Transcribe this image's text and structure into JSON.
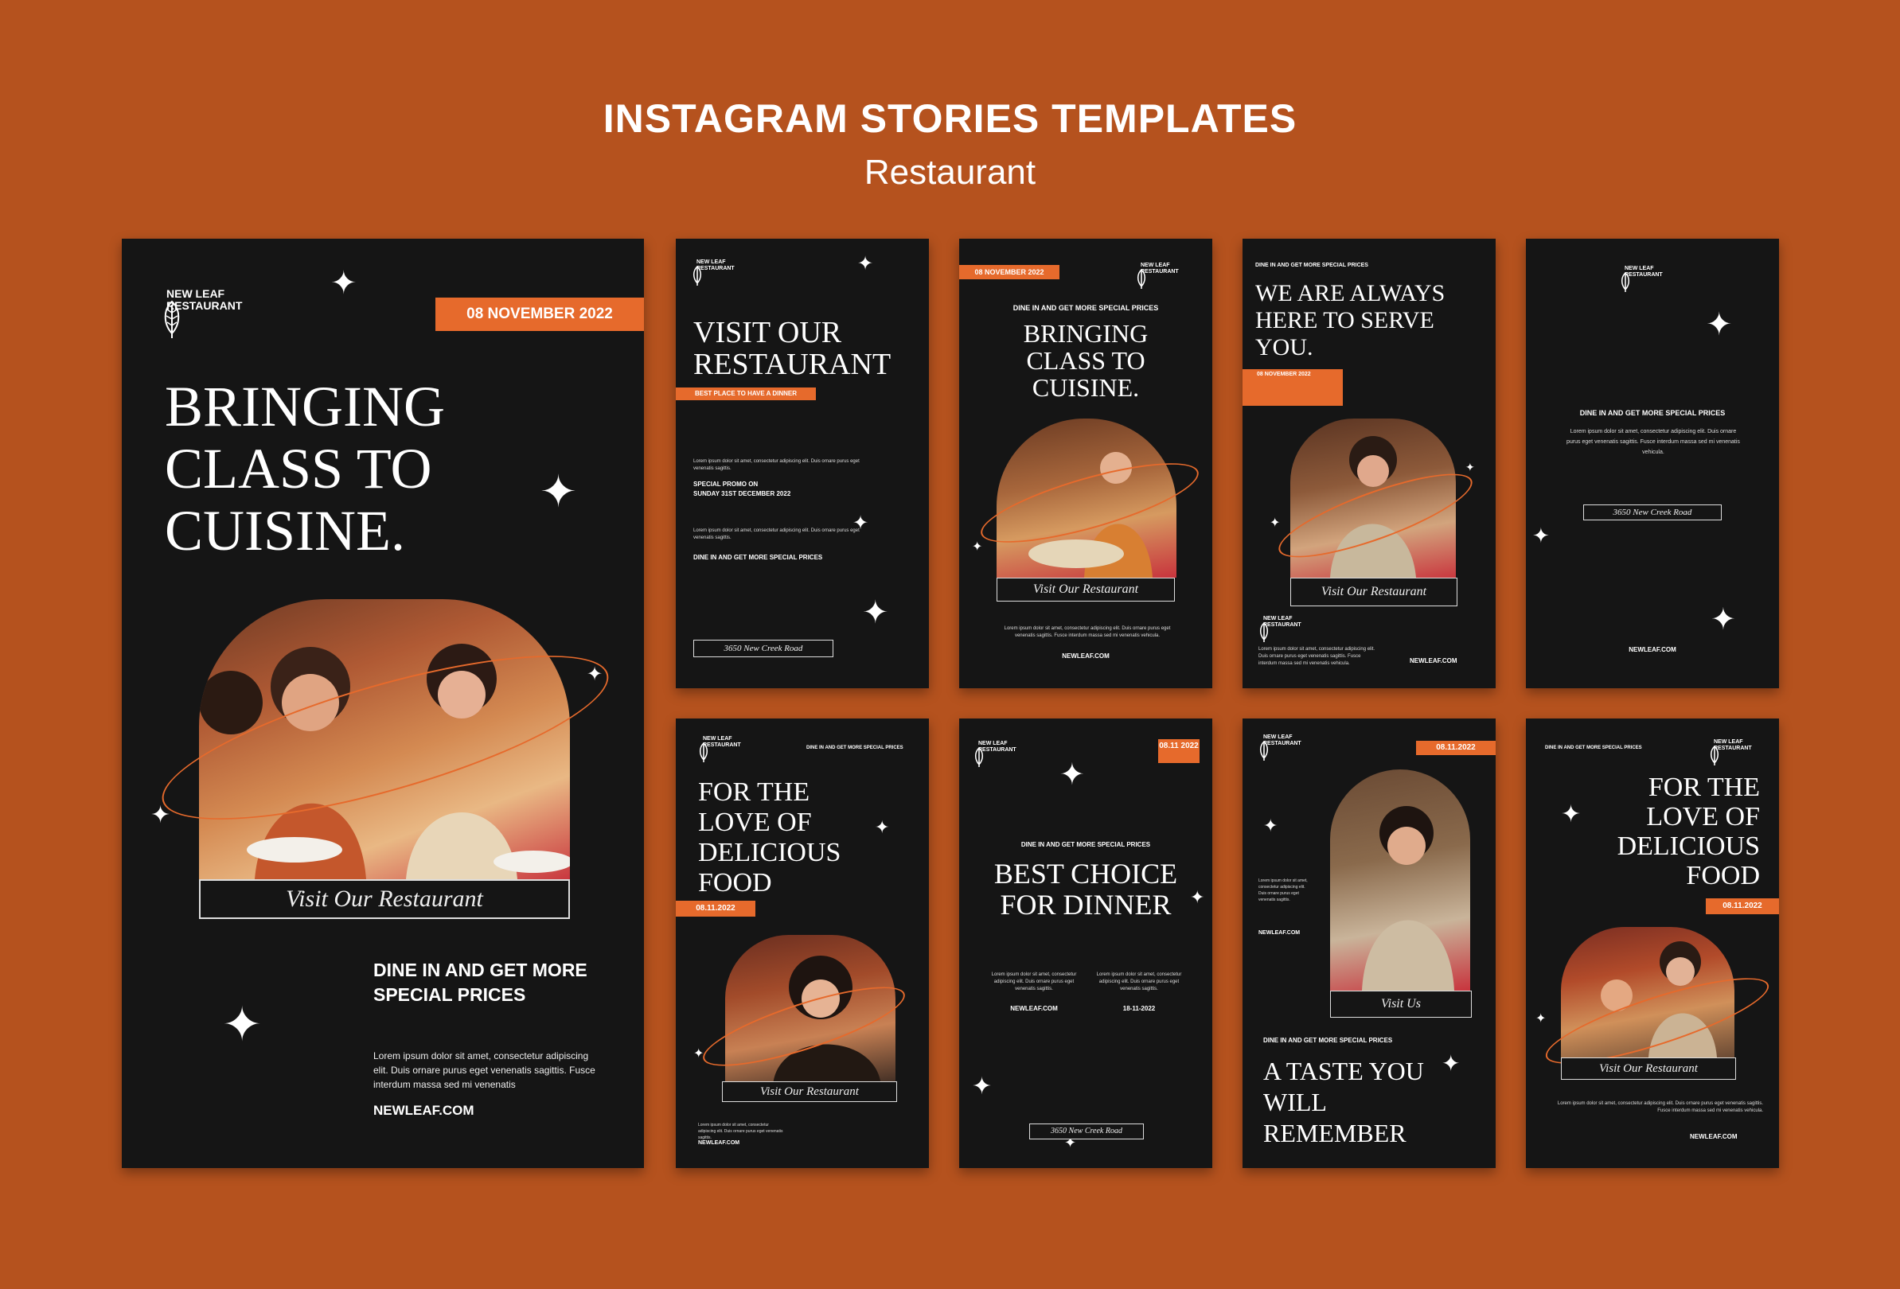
{
  "header": {
    "title": "INSTAGRAM STORIES TEMPLATES",
    "subtitle": "Restaurant"
  },
  "brand": {
    "line1": "NEW LEAF",
    "line2": "RESTAURANT",
    "website": "NEWLEAF.COM",
    "address": "3650 New Creek Road",
    "accent": "#e66a2c"
  },
  "lorem": {
    "long": "Lorem ipsum dolor sit amet, consectetur adipiscing elit. Duis ornare purus eget venenatis sagittis. Fusce interdum massa sed mi venenatis vehicula.",
    "big": "Lorem ipsum dolor sit amet, consectetur adipiscing elit. Duis ornare purus eget venenatis sagittis. Fusce interdum massa sed mi venenatis",
    "short": "Lorem ipsum dolor sit amet, consectetur adipiscing elit. Duis ornare purus eget venenatis sagittis."
  },
  "card1": {
    "date": "08 NOVEMBER 2022",
    "headline": "BRINGING CLASS TO CUISINE.",
    "cta": "Visit Our Restaurant",
    "promo": "DINE IN AND GET MORE SPECIAL PRICES"
  },
  "card2": {
    "headline": "VISIT OUR RESTAURANT",
    "tag": "BEST PLACE TO HAVE A DINNER",
    "promo_label": "SPECIAL PROMO ON",
    "promo_date": "SUNDAY 31ST DECEMBER 2022",
    "promo": "DINE IN AND GET MORE SPECIAL PRICES"
  },
  "card3": {
    "date": "08 NOVEMBER 2022",
    "promo": "DINE IN AND GET MORE SPECIAL PRICES",
    "headline": "BRINGING CLASS TO CUISINE.",
    "cta": "Visit Our Restaurant"
  },
  "card4": {
    "promo": "DINE IN AND GET MORE SPECIAL PRICES",
    "headline": "WE ARE ALWAYS HERE TO SERVE YOU.",
    "date": "08 NOVEMBER 2022",
    "cta": "Visit Our Restaurant"
  },
  "card5": {
    "promo": "DINE IN AND GET MORE SPECIAL PRICES"
  },
  "card6": {
    "promo": "DINE IN AND GET MORE SPECIAL PRICES",
    "headline": "FOR THE LOVE OF DELICIOUS FOOD",
    "date": "08.11.2022",
    "cta": "Visit Our Restaurant"
  },
  "card7": {
    "date": "08.11 2022",
    "promo": "DINE IN AND GET MORE SPECIAL PRICES",
    "headline": "BEST CHOICE FOR DINNER",
    "date2": "18-11-2022"
  },
  "card8": {
    "date": "08.11.2022",
    "cta": "Visit Us",
    "promo": "DINE IN AND GET MORE SPECIAL PRICES",
    "headline": "A TASTE YOU WILL REMEMBER"
  },
  "card9": {
    "promo": "DINE IN AND GET MORE SPECIAL PRICES",
    "headline": "FOR THE LOVE OF DELICIOUS FOOD",
    "date": "08.11.2022",
    "cta": "Visit Our Restaurant"
  }
}
